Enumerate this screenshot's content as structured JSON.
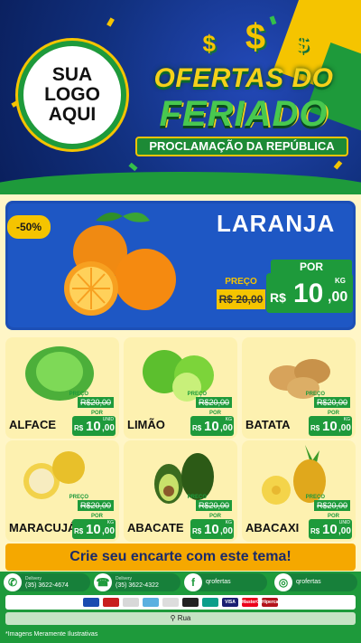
{
  "logo": {
    "line1": "SUA",
    "line2": "LOGO",
    "line3": "AQUI"
  },
  "header": {
    "dollar": "$",
    "title1": "OFERTAS DO",
    "title2": "FERIADO",
    "subtitle": "PROCLAMAÇÃO DA REPÚBLICA"
  },
  "hero": {
    "discount": "-50%",
    "name": "LARANJA",
    "preco_label": "PREÇO",
    "old_price": "R$ 20,00",
    "por_label": "POR",
    "currency": "R$",
    "price_int": "10",
    "price_cents": ",00",
    "unit": "KG"
  },
  "products": [
    {
      "name": "ALFACE",
      "preco_label": "PREÇO",
      "old_price": "R$20,00",
      "por_label": "POR",
      "currency": "R$",
      "price_int": "10",
      "price_cents": ",00",
      "unit": "UNID"
    },
    {
      "name": "LIMÃO",
      "preco_label": "PREÇO",
      "old_price": "R$20,00",
      "por_label": "POR",
      "currency": "R$",
      "price_int": "10",
      "price_cents": ",00",
      "unit": "KG"
    },
    {
      "name": "BATATA",
      "preco_label": "PREÇO",
      "old_price": "R$20,00",
      "por_label": "POR",
      "currency": "R$",
      "price_int": "10",
      "price_cents": ",00",
      "unit": "KG"
    },
    {
      "name": "MARACUJÁ",
      "preco_label": "PREÇO",
      "old_price": "R$20,00",
      "por_label": "POR",
      "currency": "R$",
      "price_int": "10",
      "price_cents": ",00",
      "unit": "KG"
    },
    {
      "name": "ABACATE",
      "preco_label": "PREÇO",
      "old_price": "R$20,00",
      "por_label": "POR",
      "currency": "R$",
      "price_int": "10",
      "price_cents": ",00",
      "unit": "KG"
    },
    {
      "name": "ABACAXI",
      "preco_label": "PREÇO",
      "old_price": "R$20,00",
      "por_label": "POR",
      "currency": "R$",
      "price_int": "10",
      "price_cents": ",00",
      "unit": "UNID"
    }
  ],
  "cta": "Crie seu encarte com este tema!",
  "contacts": [
    {
      "icon": "whatsapp-icon",
      "label": "Delivery",
      "value": "(35) 3622-4674"
    },
    {
      "icon": "phone-icon",
      "label": "Delivery",
      "value": "(35) 3622-4322"
    },
    {
      "icon": "facebook-icon",
      "label": "",
      "value": "qrofertas"
    },
    {
      "icon": "instagram-icon",
      "label": "",
      "value": "qrofertas"
    }
  ],
  "payments": [
    "visa-icon",
    "mastercard-icon",
    "elo-icon",
    "amex-icon",
    "hipercard-icon",
    "pix-icon"
  ],
  "payment_labels": {
    "visa": "VISA",
    "master": "MasterCard",
    "hiper": "Hipercard"
  },
  "address": "Rua",
  "note": "*Imagens Meramente Ilustrativas",
  "colors": {
    "blue": "#1e57c4",
    "green": "#1e9a3b",
    "yellow": "#f5c400",
    "cream": "#fdf1b0"
  }
}
